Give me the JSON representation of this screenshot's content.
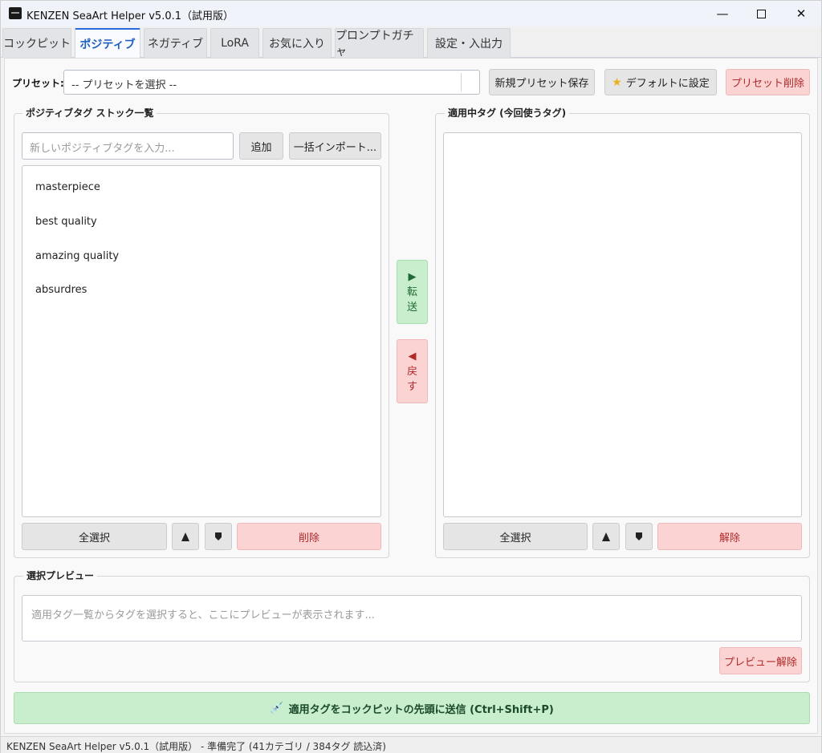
{
  "window": {
    "title": "KENZEN SeaArt Helper v5.0.1（試用版）",
    "minimize_icon": "minimize-icon",
    "maximize_icon": "maximize-icon",
    "close_icon": "close-icon"
  },
  "tabs": [
    {
      "label": "コックピット"
    },
    {
      "label": "ポジティブ",
      "active": true
    },
    {
      "label": "ネガティブ"
    },
    {
      "label": "LoRA"
    },
    {
      "label": "お気に入り"
    },
    {
      "label": "プロンプトガチャ"
    },
    {
      "label": "設定・入出力"
    }
  ],
  "preset": {
    "label": "プリセット:",
    "selected": "-- プリセットを選択 --",
    "save_button": "新規プリセット保存",
    "default_button": "デフォルトに設定",
    "delete_button": "プリセット削除"
  },
  "stock": {
    "title": "ポジティブタグ ストック一覧",
    "input_placeholder": "新しいポジティブタグを入力...",
    "add_button": "追加",
    "import_button": "一括インポート...",
    "items": [
      "masterpiece",
      "best quality",
      "amazing quality",
      "absurdres"
    ],
    "select_all_button": "全選択",
    "delete_button": "削除"
  },
  "transfer": {
    "forward_arrow": "▶",
    "forward_label_1": "転",
    "forward_label_2": "送",
    "back_arrow": "◀",
    "back_label_1": "戻",
    "back_label_2": "す"
  },
  "active": {
    "title": "適用中タグ (今回使うタグ)",
    "items": [],
    "select_all_button": "全選択",
    "release_button": "解除"
  },
  "preview": {
    "title": "選択プレビュー",
    "placeholder": "適用タグ一覧からタグを選択すると、ここにプレビューが表示されます...",
    "clear_button": "プレビュー解除"
  },
  "send": {
    "label": "適用タグをコックピットの先頭に送信 (Ctrl+Shift+P)",
    "icon": "syringe-icon"
  },
  "status": {
    "text": "KENZEN SeaArt Helper v5.0.1（試用版） - 準備完了 (41カテゴリ / 384タグ 読込済)"
  },
  "colors": {
    "accent": "#2a6ae0",
    "green_button": "#c8eecd",
    "red_button": "#fcd3d3"
  }
}
